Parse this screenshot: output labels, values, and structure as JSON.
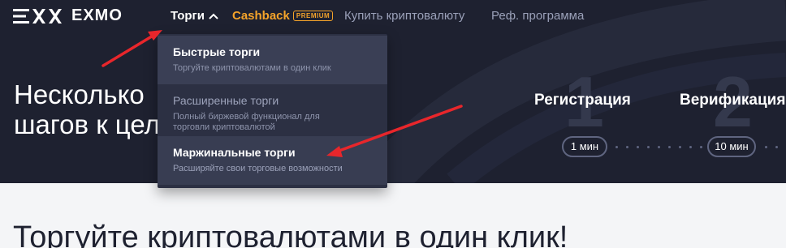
{
  "header": {
    "logo_text": "EXMO",
    "nav": {
      "torgi": "Торги",
      "cashback": "Cashback",
      "premium_badge": "PREMIUM",
      "buy_crypto": "Купить криптовалюту",
      "referral": "Реф. программа"
    }
  },
  "dropdown": {
    "items": [
      {
        "title": "Быстрые торги",
        "description": "Торгуйте криптовалютами в один клик"
      },
      {
        "title": "Расширенные торги",
        "description": "Полный биржевой функционал для\nторговли криптовалютой"
      },
      {
        "title": "Маржинальные торги",
        "description": "Расширяйте свои торговые возможности"
      }
    ]
  },
  "hero": {
    "headline": "Несколько\nшагов к цел",
    "steps": [
      {
        "number": "1",
        "label": "Регистрация",
        "time": "1 мин"
      },
      {
        "number": "2",
        "label": "Верификация",
        "time": "10 мин"
      }
    ]
  },
  "main": {
    "heading": "Торгуйте криптовалютами в один клик!"
  },
  "colors": {
    "hero_bg": "#1e2130",
    "accent_orange": "#f4a32a",
    "dropdown_bg": "#2c3043",
    "annotation_arrow": "#e8262b"
  }
}
